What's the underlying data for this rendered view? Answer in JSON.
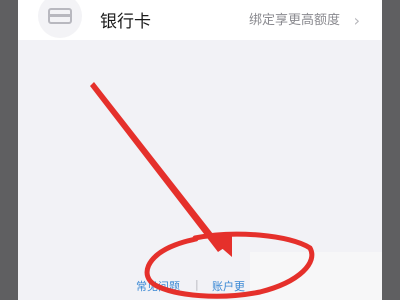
{
  "bank_card": {
    "title": "银行卡",
    "hint": "绑定享更高额度",
    "icon": "card-icon",
    "chevron_icon": "chevron-right-icon"
  },
  "footer_links": {
    "faq": "常见问题",
    "separator": "|",
    "account": "账户更"
  },
  "annotation": {
    "color": "#e5302b"
  }
}
